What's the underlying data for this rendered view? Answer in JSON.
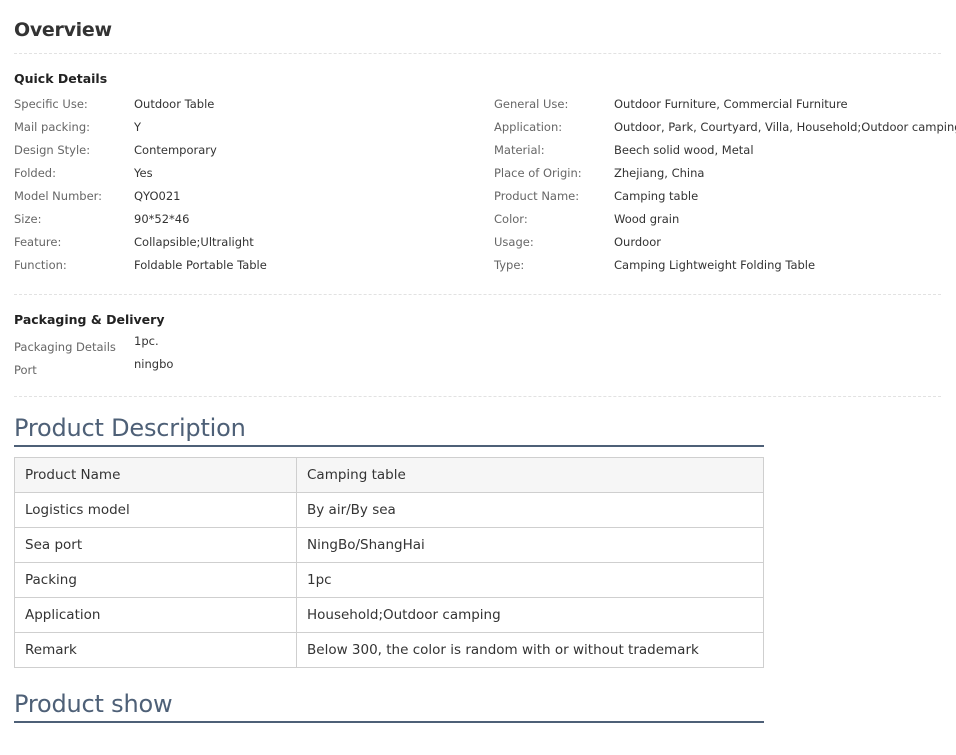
{
  "overview": {
    "title": "Overview"
  },
  "quick_details": {
    "heading": "Quick Details",
    "left": [
      {
        "label": "Specific Use:",
        "value": "Outdoor Table"
      },
      {
        "label": "Mail packing:",
        "value": "Y"
      },
      {
        "label": "Design Style:",
        "value": "Contemporary"
      },
      {
        "label": "Folded:",
        "value": "Yes"
      },
      {
        "label": "Model Number:",
        "value": "QYO021"
      },
      {
        "label": "Size:",
        "value": "90*52*46"
      },
      {
        "label": "Feature:",
        "value": "Collapsible;Ultralight"
      },
      {
        "label": "Function:",
        "value": "Foldable Portable Table"
      }
    ],
    "right": [
      {
        "label": "General Use:",
        "value": "Outdoor Furniture, Commercial Furniture"
      },
      {
        "label": "Application:",
        "value": "Outdoor, Park, Courtyard, Villa, Household;Outdoor camping"
      },
      {
        "label": "Material:",
        "value": "Beech solid wood, Metal"
      },
      {
        "label": "Place of Origin:",
        "value": "Zhejiang, China"
      },
      {
        "label": "Product Name:",
        "value": "Camping table"
      },
      {
        "label": "Color:",
        "value": "Wood grain"
      },
      {
        "label": "Usage:",
        "value": "Ourdoor"
      },
      {
        "label": "Type:",
        "value": "Camping Lightweight Folding Table"
      }
    ]
  },
  "packaging": {
    "heading": "Packaging & Delivery",
    "rows": [
      {
        "label": "Packaging Details",
        "value": "1pc."
      },
      {
        "label": "Port",
        "value": "ningbo"
      }
    ]
  },
  "product_description": {
    "heading": "Product Description",
    "rows": [
      [
        "Product Name",
        "Camping table"
      ],
      [
        "Logistics model",
        "By air/By sea"
      ],
      [
        "Sea port",
        "NingBo/ShangHai"
      ],
      [
        "Packing",
        "1pc"
      ],
      [
        "Application",
        "Household;Outdoor camping"
      ],
      [
        "Remark",
        "Below 300, the color is random with or without trademark"
      ]
    ]
  },
  "product_show": {
    "heading": "Product show"
  }
}
